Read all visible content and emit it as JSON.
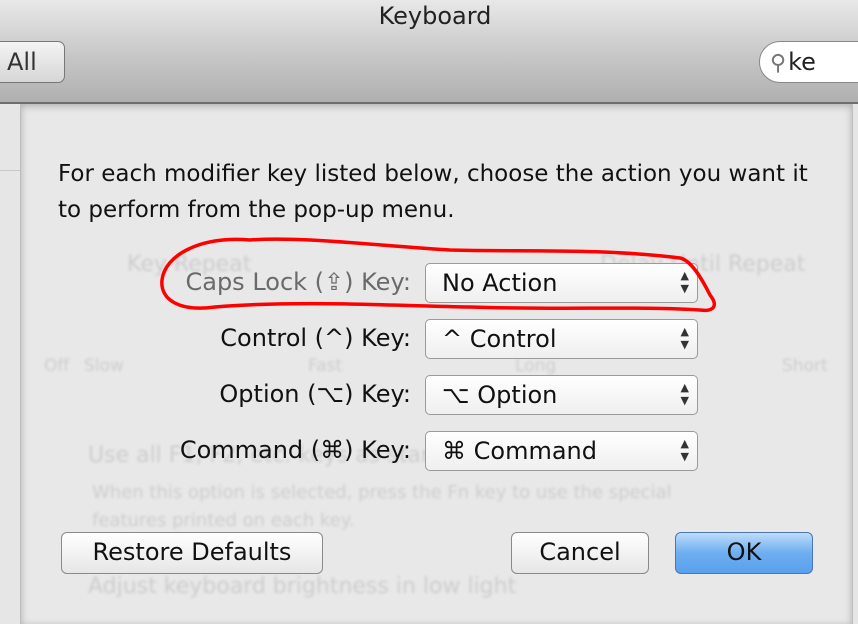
{
  "window": {
    "title": "Keyboard"
  },
  "toolbar": {
    "show_all_label": "All",
    "search_value": "ke",
    "search_icon": "magnifier-icon"
  },
  "background": {
    "key_repeat": "Key Repeat",
    "delay_until_repeat": "Delay Until Repeat",
    "off": "Off",
    "slow": "Slow",
    "fast": "Fast",
    "long": "Long",
    "short": "Short",
    "fn_keys": "Use all F1, F2, etc. keys as standard function keys",
    "fn_desc_1": "When this option is selected, press the Fn key to use the special",
    "fn_desc_2": "features printed on each key.",
    "brightness": "Adjust keyboard brightness in low light"
  },
  "sheet": {
    "intro": "For each modifier key listed below, choose the action you want it to perform from the pop-up menu.",
    "rows": [
      {
        "label": "Caps Lock (⇪) Key:",
        "value": "No Action",
        "dimmed": true
      },
      {
        "label": "Control (^) Key:",
        "value": "^ Control"
      },
      {
        "label": "Option (⌥) Key:",
        "value": "⌥ Option"
      },
      {
        "label": "Command (⌘) Key:",
        "value": "⌘ Command"
      }
    ],
    "restore_label": "Restore Defaults",
    "cancel_label": "Cancel",
    "ok_label": "OK"
  },
  "annotation": {
    "color": "#ff0000"
  }
}
